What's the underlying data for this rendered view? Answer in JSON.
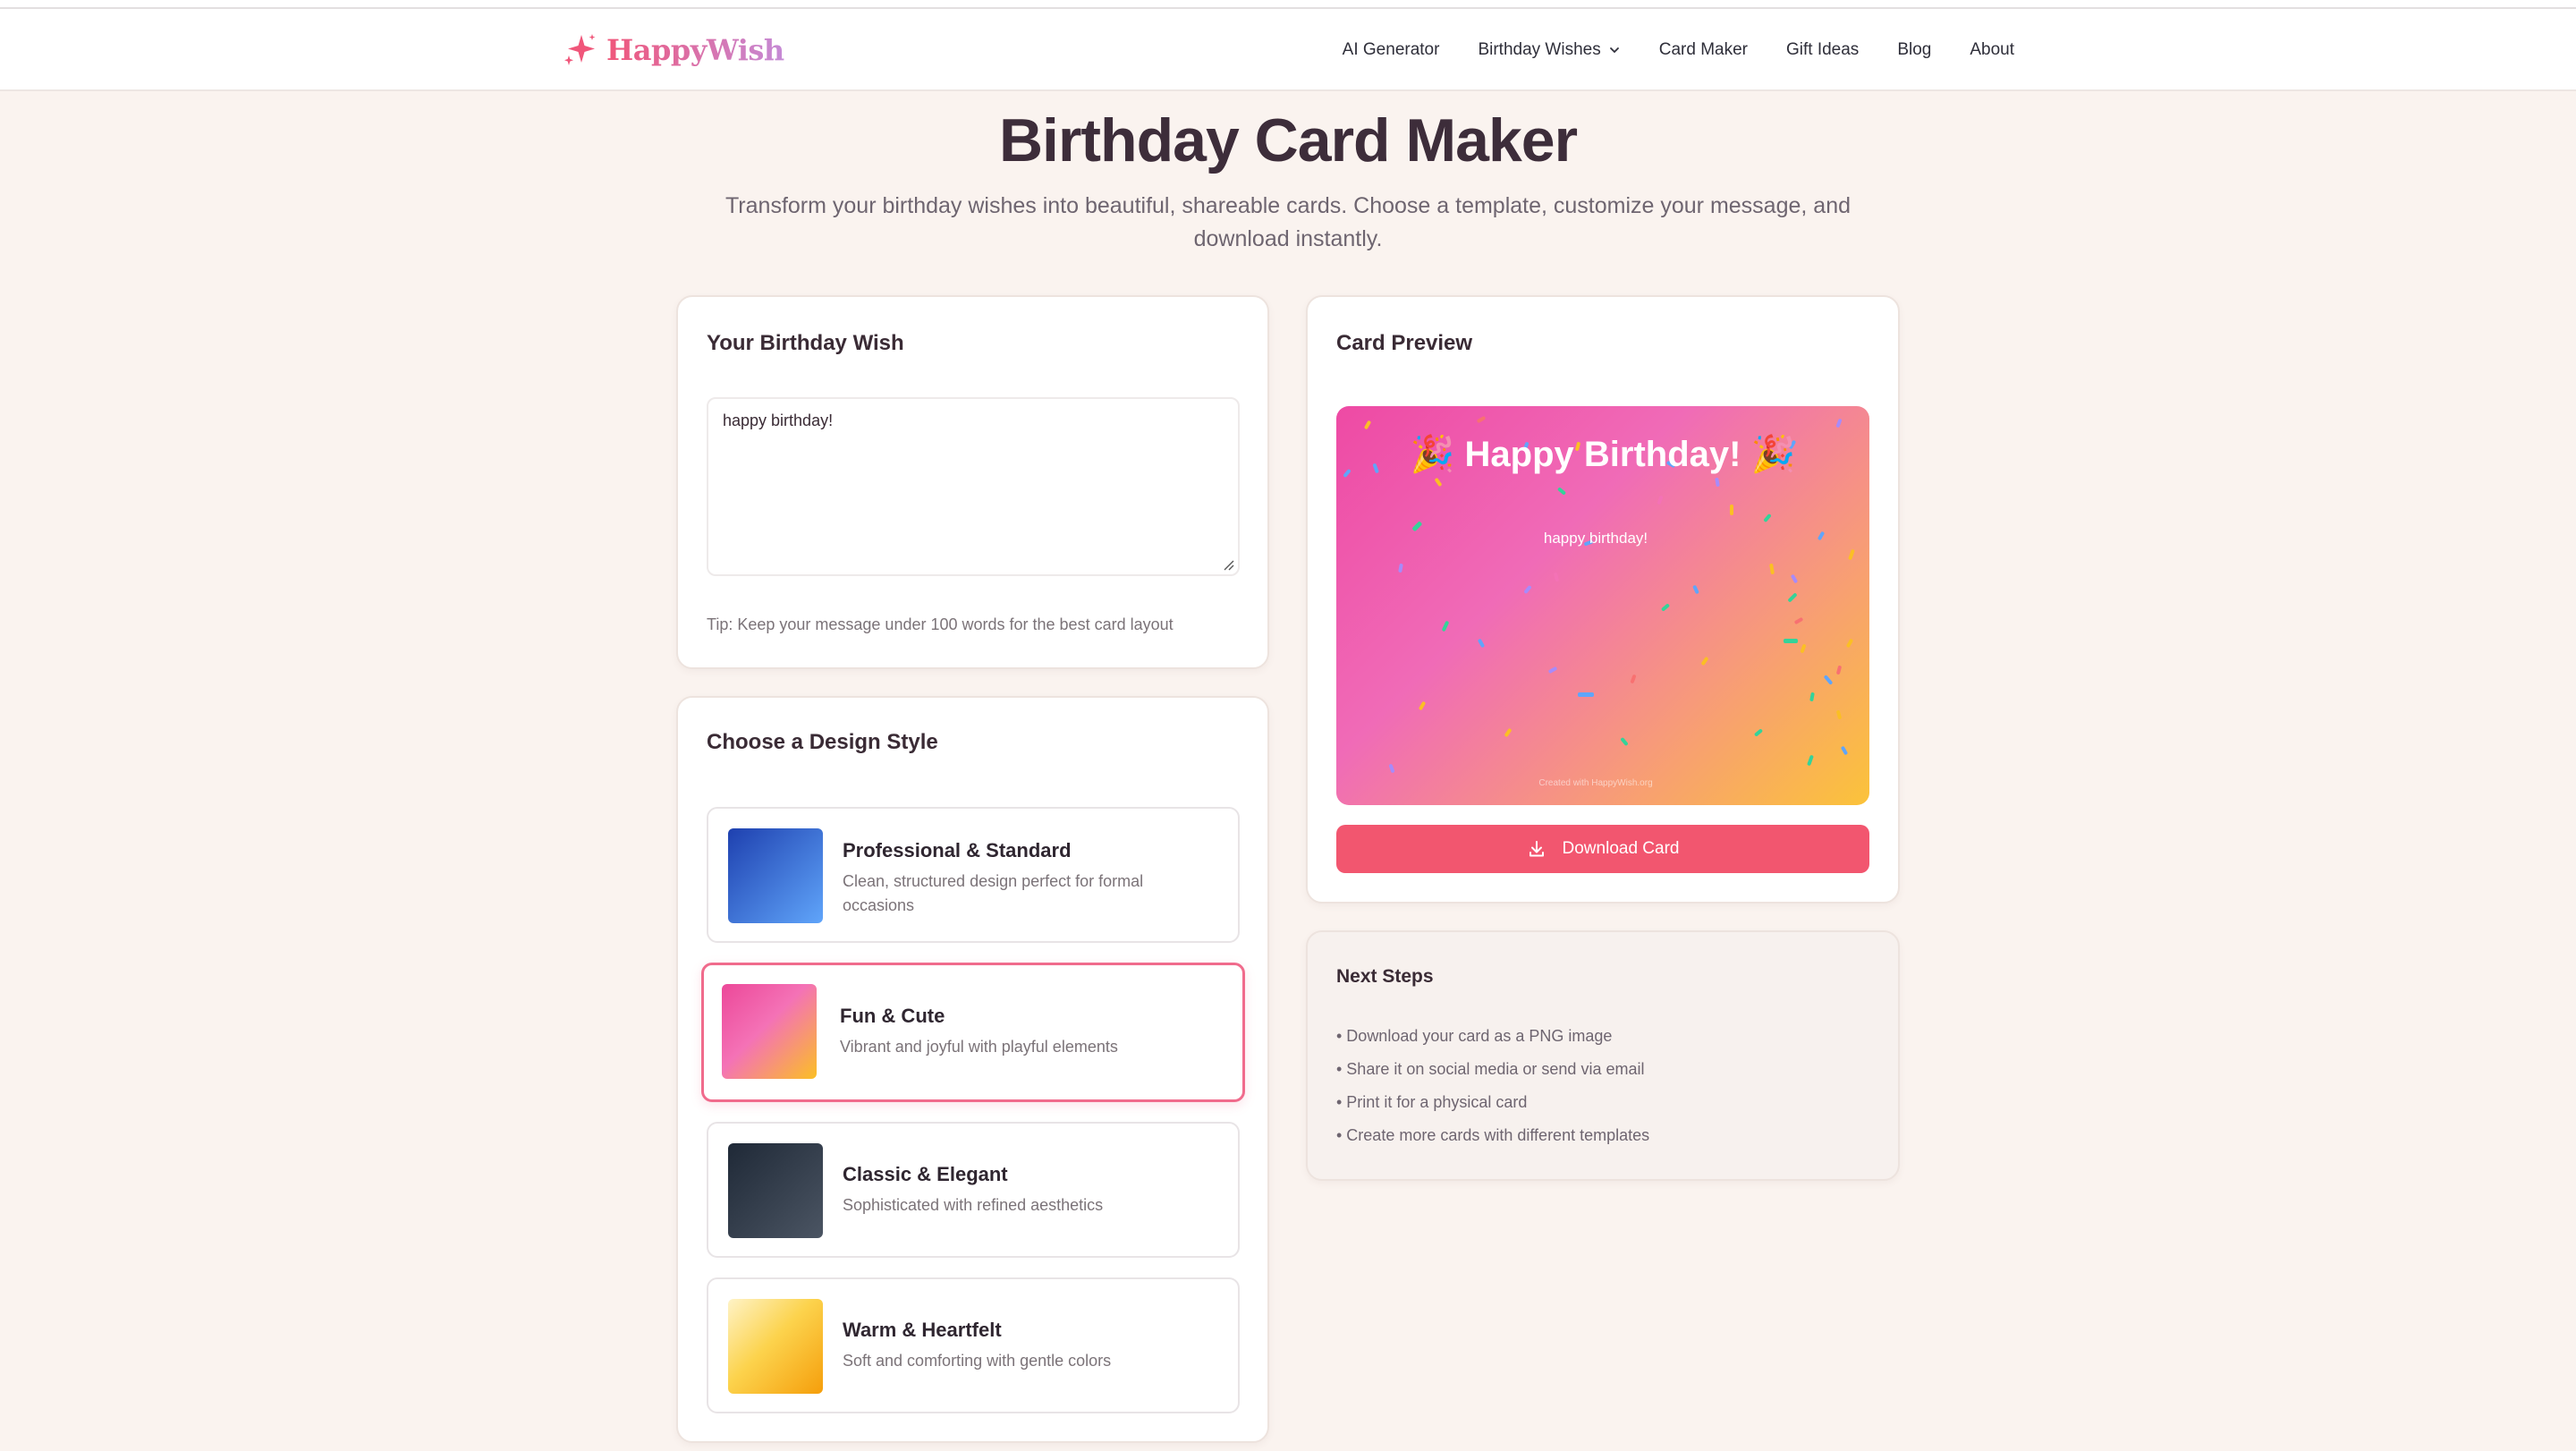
{
  "brand": {
    "name": "HappyWish",
    "icon": "sparkle-icon"
  },
  "nav": {
    "ai_generator": "AI Generator",
    "birthday_wishes": "Birthday Wishes",
    "card_maker": "Card Maker",
    "gift_ideas": "Gift Ideas",
    "blog": "Blog",
    "about": "About"
  },
  "hero": {
    "title": "Birthday Card Maker",
    "subtitle": "Transform your birthday wishes into beautiful, shareable cards. Choose a template, customize your message, and download instantly."
  },
  "wish": {
    "title": "Your Birthday Wish",
    "value": "happy birthday!",
    "tip": "Tip: Keep your message under 100 words for the best card layout"
  },
  "styles": {
    "title": "Choose a Design Style",
    "options": [
      {
        "title": "Professional & Standard",
        "desc": "Clean, structured design perfect for formal occasions",
        "color_from": "#1e40af",
        "color_to": "#60a5fa"
      },
      {
        "title": "Fun & Cute",
        "desc": "Vibrant and joyful with playful elements",
        "color_from": "#ec4899",
        "color_to": "#fbbf24",
        "selected": true
      },
      {
        "title": "Classic & Elegant",
        "desc": "Sophisticated with refined aesthetics",
        "color_from": "#1f2937",
        "color_to": "#4b5563"
      },
      {
        "title": "Warm & Heartfelt",
        "desc": "Soft and comforting with gentle colors",
        "color_from": "#fef3c7",
        "color_to": "#f59e0b"
      }
    ]
  },
  "preview": {
    "title": "Card Preview",
    "card_heading": "🎉 Happy Birthday! 🎉",
    "card_message": "happy birthday!",
    "card_credit": "Created with HappyWish.org",
    "download_label": "Download Card"
  },
  "next_steps": {
    "title": "Next Steps",
    "items": [
      "• Download your card as a PNG image",
      "• Share it on social media or send via email",
      "• Print it for a physical card",
      "• Create more cards with different templates"
    ]
  },
  "colors": {
    "accent": "#f2566f",
    "page_bg": "#faf3ef",
    "selected_border": "#f06b8c"
  }
}
